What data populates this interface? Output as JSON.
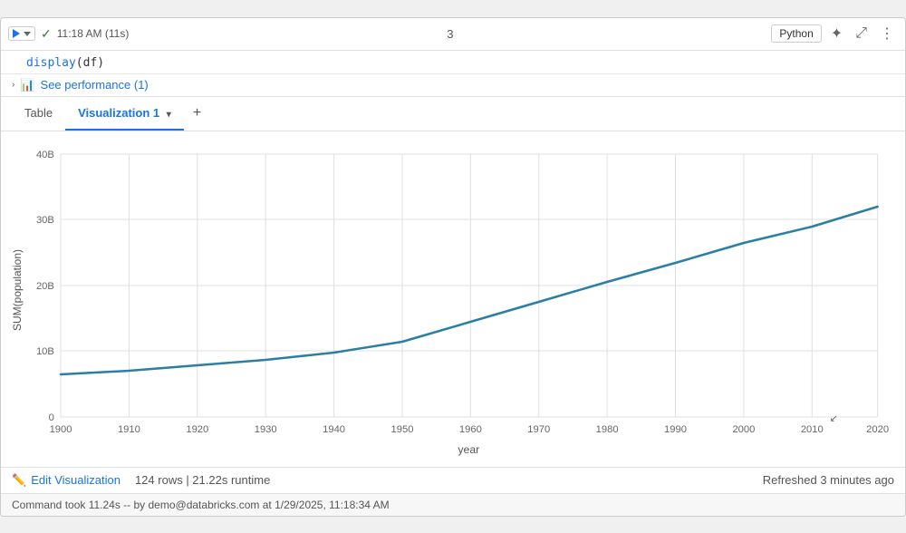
{
  "toolbar": {
    "status": "11:18 AM (11s)",
    "cell_number": "3",
    "python_label": "Python",
    "expand_icon": "⤢",
    "more_icon": "⋮",
    "magic_icon": "✦"
  },
  "code": {
    "line": "display(df)"
  },
  "performance": {
    "link_text": "See performance (1)"
  },
  "tabs": {
    "tab1_label": "Table",
    "tab2_label": "Visualization 1",
    "add_label": "+"
  },
  "chart": {
    "y_axis_label": "SUM(population)",
    "x_axis_label": "year",
    "y_ticks": [
      "40B",
      "30B",
      "20B",
      "10B",
      "0"
    ],
    "x_ticks": [
      "1900",
      "1910",
      "1920",
      "1930",
      "1940",
      "1950",
      "1960",
      "1970",
      "1980",
      "1990",
      "2000",
      "2010",
      "2020"
    ],
    "line_color": "#2a7fa5",
    "data_points": [
      {
        "year": 1900,
        "value": 6.5
      },
      {
        "year": 1910,
        "value": 7.0
      },
      {
        "year": 1920,
        "value": 7.8
      },
      {
        "year": 1930,
        "value": 8.7
      },
      {
        "year": 1940,
        "value": 9.8
      },
      {
        "year": 1950,
        "value": 11.5
      },
      {
        "year": 1960,
        "value": 14.5
      },
      {
        "year": 1970,
        "value": 17.5
      },
      {
        "year": 1980,
        "value": 20.5
      },
      {
        "year": 1990,
        "value": 23.5
      },
      {
        "year": 2000,
        "value": 26.5
      },
      {
        "year": 2010,
        "value": 29.0
      },
      {
        "year": 2020,
        "value": 32.0
      }
    ]
  },
  "bottom_bar": {
    "edit_label": "Edit Visualization",
    "stats": "124 rows  |  21.22s runtime",
    "refreshed": "Refreshed 3 minutes ago"
  },
  "footer": {
    "text": "Command took 11.24s -- by demo@databricks.com at 1/29/2025, 11:18:34 AM"
  }
}
